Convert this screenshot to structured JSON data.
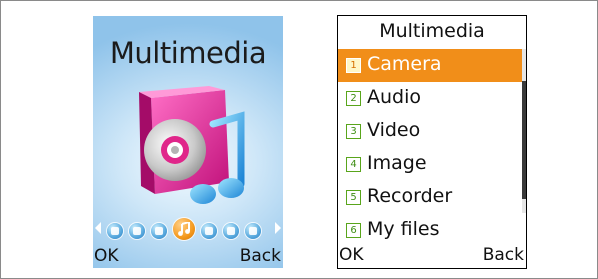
{
  "screen1": {
    "title": "Multimedia",
    "hero_icon": "multimedia-disc-music-icon",
    "carousel": [
      {
        "name": "messages-icon"
      },
      {
        "name": "call-icon"
      },
      {
        "name": "contacts-icon"
      },
      {
        "name": "multimedia-icon",
        "active": true
      },
      {
        "name": "settings-icon"
      },
      {
        "name": "organizer-icon"
      },
      {
        "name": "sos-icon"
      }
    ],
    "softkeys": {
      "left": "OK",
      "right": "Back"
    }
  },
  "screen2": {
    "title": "Multimedia",
    "items": [
      {
        "num": "1",
        "label": "Camera",
        "selected": true
      },
      {
        "num": "2",
        "label": "Audio"
      },
      {
        "num": "3",
        "label": "Video"
      },
      {
        "num": "4",
        "label": "Image"
      },
      {
        "num": "5",
        "label": "Recorder"
      },
      {
        "num": "6",
        "label": "My files"
      }
    ],
    "softkeys": {
      "left": "OK",
      "right": "Back"
    }
  },
  "colors": {
    "selection": "#f18e19",
    "hero_magenta": "#e0268a",
    "carousel_blue": "#58a9de"
  }
}
